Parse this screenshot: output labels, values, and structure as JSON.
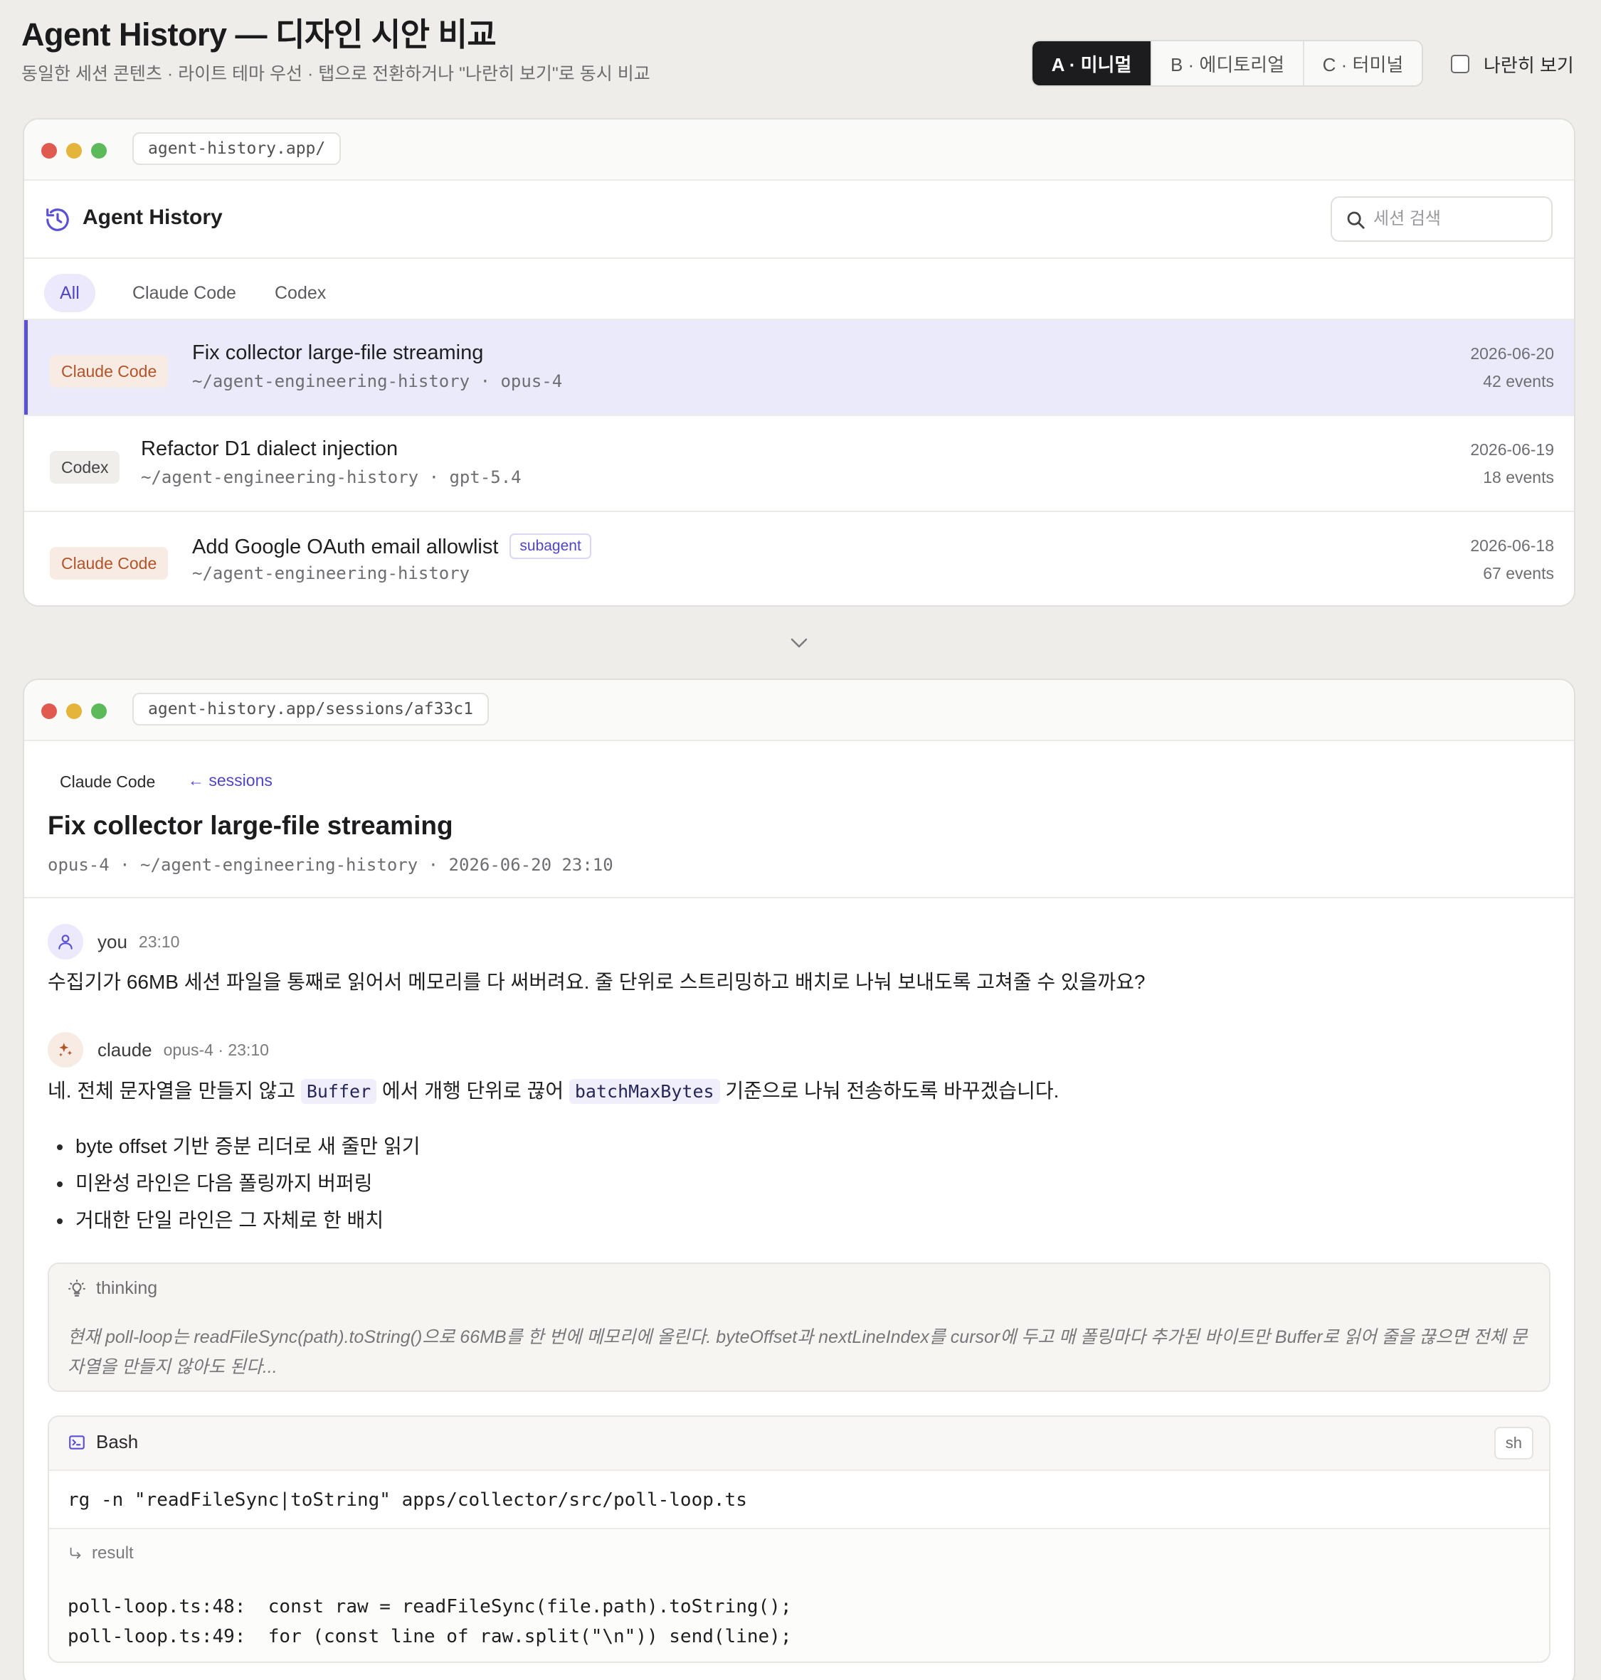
{
  "header": {
    "title": "Agent History — 디자인 시안 비교",
    "subtitle": "동일한 세션 콘텐츠 · 라이트 테마 우선 · 탭으로 전환하거나 \"나란히 보기\"로 동시 비교",
    "variants": [
      {
        "label": "A · 미니멀",
        "active": true
      },
      {
        "label": "B · 에디토리얼",
        "active": false
      },
      {
        "label": "C · 터미널",
        "active": false
      }
    ],
    "side_by_side_label": "나란히 보기",
    "side_by_side_checked": false
  },
  "list_window": {
    "url": "agent-history.app/",
    "app_name": "Agent History",
    "search_placeholder": "세션 검색",
    "filters": [
      "All",
      "Claude Code",
      "Codex"
    ],
    "active_filter": "All",
    "sessions": [
      {
        "agent": "Claude Code",
        "title": "Fix collector large-file streaming",
        "meta": "~/agent-engineering-history · opus-4",
        "date": "2026-06-20",
        "events": "42 events",
        "selected": true
      },
      {
        "agent": "Codex",
        "title": "Refactor D1 dialect injection",
        "meta": "~/agent-engineering-history · gpt-5.4",
        "date": "2026-06-19",
        "events": "18 events",
        "selected": false
      },
      {
        "agent": "Claude Code",
        "title": "Add Google OAuth email allowlist",
        "tag": "subagent",
        "meta": "~/agent-engineering-history",
        "date": "2026-06-18",
        "events": "67 events",
        "selected": false
      }
    ]
  },
  "detail_window": {
    "url": "agent-history.app/sessions/af33c1",
    "agent": "Claude Code",
    "back_label": "sessions",
    "title": "Fix collector large-file streaming",
    "meta": "opus-4 · ~/agent-engineering-history · 2026-06-20 23:10",
    "user_message": {
      "author": "you",
      "time": "23:10",
      "text": "수집기가 66MB 세션 파일을 통째로 읽어서 메모리를 다 써버려요. 줄 단위로 스트리밍하고 배치로 나눠 보내도록 고쳐줄 수 있을까요?"
    },
    "assistant_message": {
      "author": "claude",
      "time": "opus-4 · 23:10",
      "text_before": "네. 전체 문자열을 만들지 않고 ",
      "code1": "Buffer",
      "text_mid": " 에서 개행 단위로 끊어 ",
      "code2": "batchMaxBytes",
      "text_after": " 기준으로 나눠 전송하도록 바꾸겠습니다.",
      "bullets": [
        "byte offset 기반 증분 리더로 새 줄만 읽기",
        "미완성 라인은 다음 폴링까지 버퍼링",
        "거대한 단일 라인은 그 자체로 한 배치"
      ]
    },
    "thinking": {
      "label": "thinking",
      "text": "현재 poll-loop는 readFileSync(path).toString()으로 66MB를 한 번에 메모리에 올린다. byteOffset과 nextLineIndex를 cursor에 두고 매 폴링마다 추가된 바이트만 Buffer로 읽어 줄을 끊으면 전체 문자열을 만들지 않아도 된다..."
    },
    "tool": {
      "name": "Bash",
      "lang": "sh",
      "command": "rg -n \"readFileSync|toString\" apps/collector/src/poll-loop.ts",
      "result_label": "result",
      "output_lines": [
        "poll-loop.ts:48:  const raw = readFileSync(file.path).toString();",
        "poll-loop.ts:49:  for (const line of raw.split(\"\\n\")) send(line);"
      ]
    }
  },
  "colors": {
    "accent": "#5a50d6",
    "claude_badge": "#b1542a",
    "selected_row": "#ebeafb"
  }
}
